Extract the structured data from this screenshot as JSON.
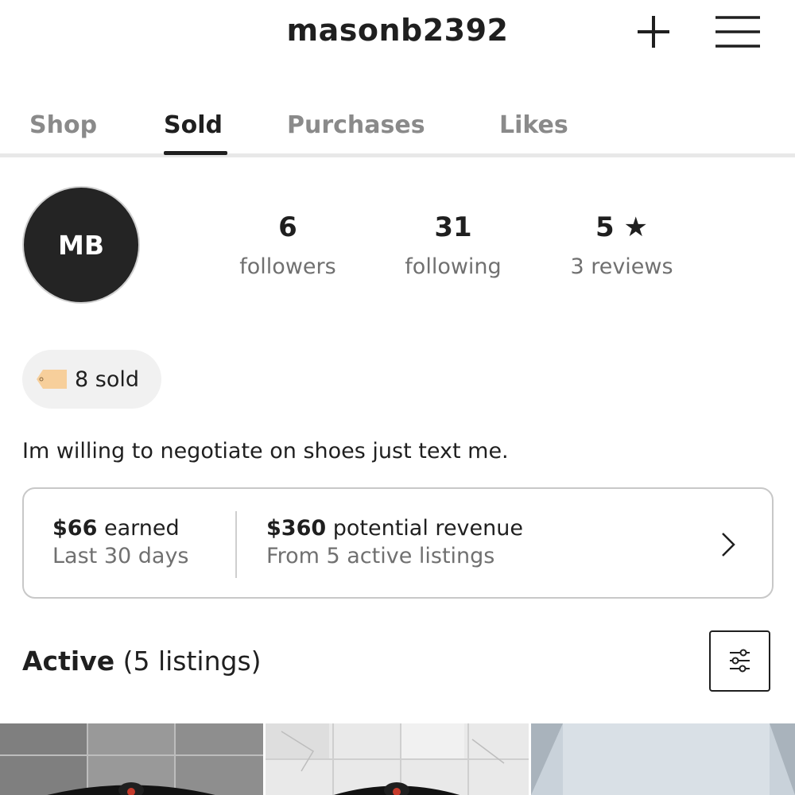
{
  "header": {
    "username": "masonb2392",
    "plus_icon": "plus-icon",
    "menu_icon": "hamburger-menu-icon"
  },
  "tabs": [
    {
      "label": "Shop",
      "active": false
    },
    {
      "label": "Sold",
      "active": true
    },
    {
      "label": "Purchases",
      "active": false
    },
    {
      "label": "Likes",
      "active": false
    }
  ],
  "profile": {
    "initials": "MB",
    "stats": {
      "followers_count": "6",
      "followers_label": "followers",
      "following_count": "31",
      "following_label": "following",
      "rating": "5",
      "rating_icon": "star-icon",
      "reviews_label": "3 reviews"
    },
    "sold_badge": "8 sold",
    "bio": "Im willing to negotiate on shoes just text me."
  },
  "earnings": {
    "earned_amount": "$66",
    "earned_label": "earned",
    "earned_period": "Last 30 days",
    "potential_amount": "$360",
    "potential_label": "potential revenue",
    "potential_source": "From 5 active listings"
  },
  "active_section": {
    "title": "Active",
    "count_text": "(5 listings)",
    "filter_icon": "sliders-filter-icon"
  },
  "colors": {
    "text_primary": "#1f1f1f",
    "text_secondary": "#707070",
    "tab_inactive": "#8a8a8a",
    "avatar_bg": "#242424",
    "tag_color": "#f7cf9b"
  }
}
